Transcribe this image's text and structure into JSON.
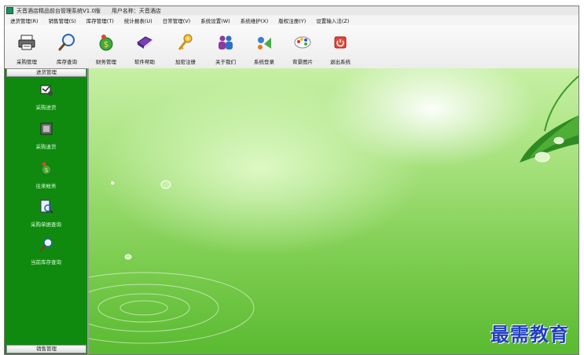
{
  "window": {
    "title": "天音酒店精品前台管理系统V1.0版",
    "user": "用户名称：天音酒店"
  },
  "menu": [
    "进货管理(R)",
    "销售管理(S)",
    "库存管理(T)",
    "统计报表(U)",
    "日常管理(V)",
    "系统设置(W)",
    "系统维护(X)",
    "版权注册(Y)",
    "设置输入法(Z)"
  ],
  "toolbar": [
    {
      "label": "采购管理",
      "icon": "printer-icon"
    },
    {
      "label": "库存查询",
      "icon": "magnifier-icon"
    },
    {
      "label": "财务管理",
      "icon": "money-icon"
    },
    {
      "label": "软件帮助",
      "icon": "book-icon"
    },
    {
      "label": "加密注册",
      "icon": "key-icon"
    },
    {
      "label": "关于我们",
      "icon": "people-icon"
    },
    {
      "label": "系统登录",
      "icon": "login-icon"
    },
    {
      "label": "背景图片",
      "icon": "palette-icon"
    },
    {
      "label": "退出系统",
      "icon": "power-icon"
    }
  ],
  "sidebar": {
    "header": "进货管理",
    "footer": "销售管理",
    "items": [
      {
        "label": "采购进货",
        "icon": "purchase-icon"
      },
      {
        "label": "采购退货",
        "icon": "return-icon"
      },
      {
        "label": "往来帐务",
        "icon": "accounts-icon"
      },
      {
        "label": "采购单据查询",
        "icon": "document-search-icon"
      },
      {
        "label": "当前库存查询",
        "icon": "stock-search-icon"
      }
    ]
  },
  "watermark": "最需教育",
  "colors": {
    "sidebar": "#0f8a0f",
    "watermark": "#1f3fbf",
    "background_green": "#7fce52"
  }
}
